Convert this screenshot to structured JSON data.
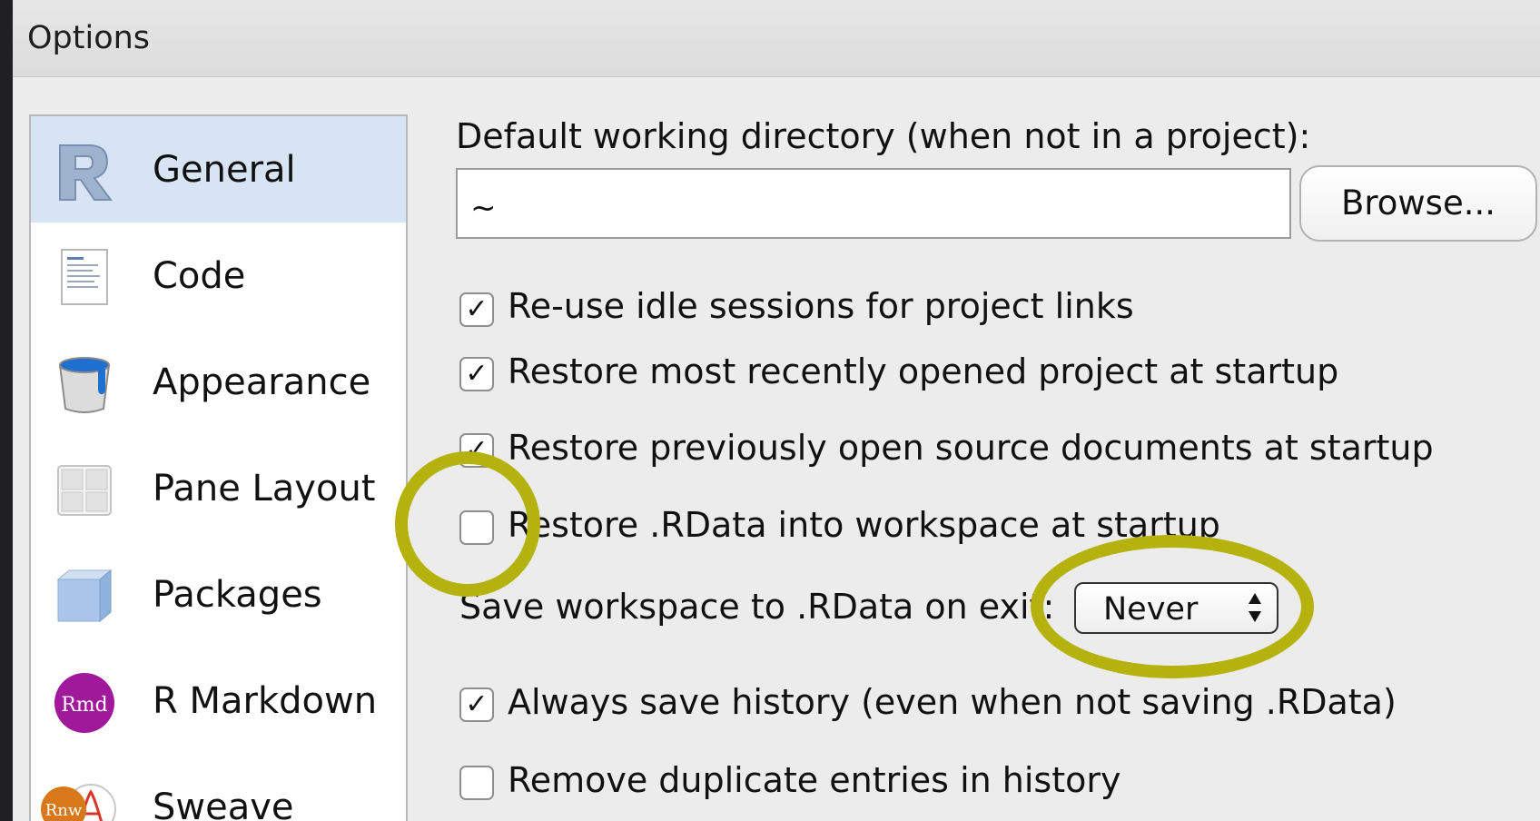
{
  "window": {
    "title": "Options"
  },
  "sidebar": {
    "items": [
      {
        "label": "General",
        "icon": "r-logo-icon",
        "selected": true
      },
      {
        "label": "Code",
        "icon": "code-document-icon",
        "selected": false
      },
      {
        "label": "Appearance",
        "icon": "paint-bucket-icon",
        "selected": false
      },
      {
        "label": "Pane Layout",
        "icon": "pane-grid-icon",
        "selected": false
      },
      {
        "label": "Packages",
        "icon": "package-box-icon",
        "selected": false
      },
      {
        "label": "R Markdown",
        "icon": "rmd-badge-icon",
        "icon_text": "Rmd",
        "selected": false
      },
      {
        "label": "Sweave",
        "icon": "sweave-pdf-icon",
        "icon_text": "Rnw",
        "selected": false
      }
    ]
  },
  "general": {
    "working_dir_label": "Default working directory (when not in a project):",
    "working_dir_value": "~",
    "browse_label": "Browse...",
    "options": [
      {
        "label": "Re-use idle sessions for project links",
        "checked": true
      },
      {
        "label": "Restore most recently opened project at startup",
        "checked": true
      },
      {
        "label": "Restore previously open source documents at startup",
        "checked": true
      },
      {
        "label": "Restore .RData into workspace at startup",
        "checked": false
      }
    ],
    "save_workspace_label": "Save workspace to .RData on exit:",
    "save_workspace_value": "Never",
    "history_options": [
      {
        "label": "Always save history (even when not saving .RData)",
        "checked": true
      },
      {
        "label": "Remove duplicate entries in history",
        "checked": false
      }
    ],
    "check_mark": "✓"
  },
  "colors": {
    "highlight": "#b5b20e",
    "selected_bg": "#d7e4f4",
    "rmd_badge": "#a0199b",
    "sweave_badge": "#d8781a"
  }
}
